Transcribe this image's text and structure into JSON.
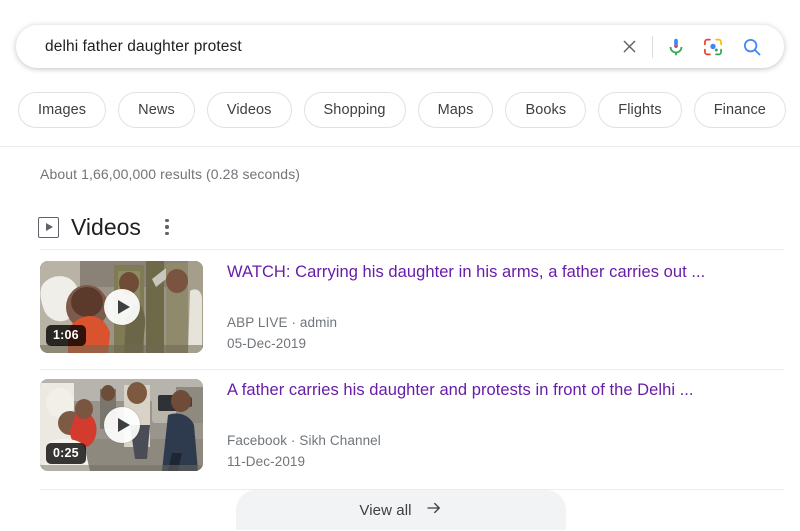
{
  "search": {
    "query": "delhi father daughter protest",
    "placeholder": "Search",
    "clear_icon": "close-icon",
    "mic_icon": "microphone-icon",
    "lens_icon": "google-lens-icon",
    "search_icon": "search-icon"
  },
  "filter_chips": [
    {
      "label": "Images"
    },
    {
      "label": "News"
    },
    {
      "label": "Videos"
    },
    {
      "label": "Shopping"
    },
    {
      "label": "Maps"
    },
    {
      "label": "Books"
    },
    {
      "label": "Flights"
    },
    {
      "label": "Finance"
    }
  ],
  "result_stats": "About 1,66,00,000 results (0.28 seconds)",
  "videos_section": {
    "title": "Videos",
    "section_icon": "video-play-box-icon",
    "menu_icon": "more-options-icon",
    "results": [
      {
        "title": "WATCH: Carrying his daughter in his arms, a father carries out ...",
        "source": "ABP LIVE · admin",
        "date": "05-Dec-2019",
        "duration": "1:06"
      },
      {
        "title": "A father carries his daughter and protests in front of the Delhi ...",
        "source": "Facebook · Sikh Channel",
        "date": "11-Dec-2019",
        "duration": "0:25"
      }
    ],
    "view_all": {
      "label": "View all",
      "icon": "arrow-right-icon"
    }
  },
  "colors": {
    "link_visited": "#681da8",
    "meta_text": "#70757a",
    "chip_border": "#dfe1e5",
    "view_all_bg": "#f1f3f4"
  }
}
